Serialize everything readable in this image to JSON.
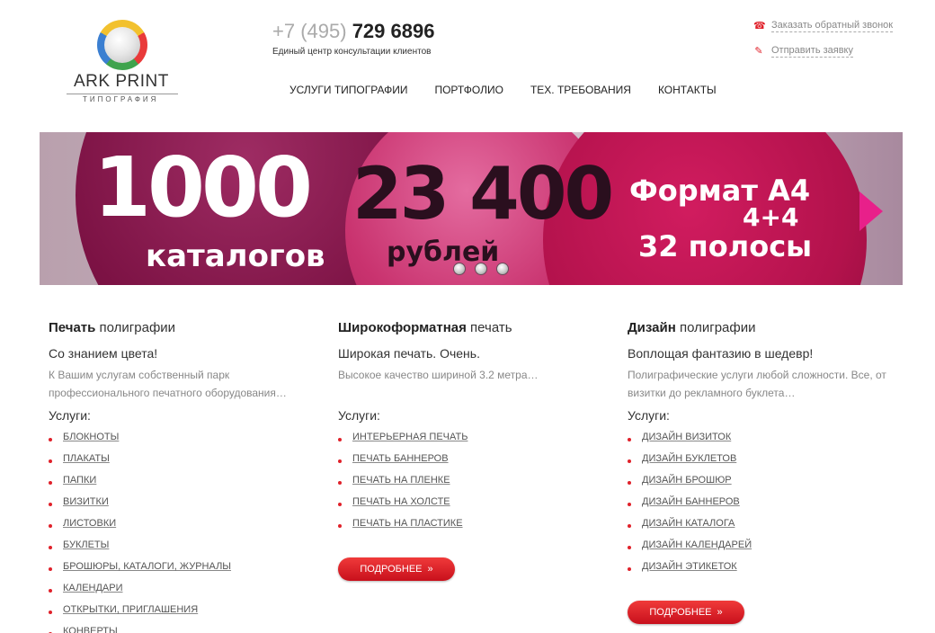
{
  "logo": {
    "name": "ARK PRINT",
    "subtitle": "ТИПОГРАФИЯ"
  },
  "header": {
    "phone_prefix": "+7 (495)",
    "phone_number": "729 6896",
    "phone_caption": "Единый центр консультации клиентов",
    "callback_link": "Заказать обратный звонок",
    "request_link": "Отправить заявку"
  },
  "nav": {
    "items": [
      "УСЛУГИ ТИПОГРАФИИ",
      "ПОРТФОЛИО",
      "ТЕХ. ТРЕБОВАНИЯ",
      "КОНТАКТЫ"
    ]
  },
  "banner": {
    "quantity": "1000",
    "quantity_label": "каталогов",
    "price": "23 400",
    "price_label": "рублей",
    "format": "Формат А4",
    "colors": "4+4",
    "pages": "32 полосы",
    "dots_count": 3
  },
  "columns": [
    {
      "title_bold": "Печать",
      "title_rest": " полиграфии",
      "tagline": "Со знанием цвета!",
      "description": "К Вашим услугам собственный парк профессионального печатного оборудования…",
      "services_label": "Услуги:",
      "services": [
        "БЛОКНОТЫ",
        "ПЛАКАТЫ",
        "ПАПКИ",
        "ВИЗИТКИ",
        "ЛИСТОВКИ",
        "БУКЛЕТЫ",
        "БРОШЮРЫ, КАТАЛОГИ, ЖУРНАЛЫ",
        "КАЛЕНДАРИ",
        "ОТКРЫТКИ, ПРИГЛАШЕНИЯ",
        "КОНВЕРТЫ"
      ]
    },
    {
      "title_bold": "Широкоформатная",
      "title_rest": " печать",
      "tagline": "Широкая печать. Очень.",
      "description": "Высокое качество шириной 3.2 метра…",
      "services_label": "Услуги:",
      "services": [
        "ИНТЕРЬЕРНАЯ ПЕЧАТЬ",
        "ПЕЧАТЬ БАННЕРОВ",
        "ПЕЧАТЬ НА ПЛЕНКЕ",
        "ПЕЧАТЬ НА ХОЛСТЕ",
        "ПЕЧАТЬ НА ПЛАСТИКЕ"
      ],
      "more_button": "ПОДРОБНЕЕ"
    },
    {
      "title_bold": "Дизайн",
      "title_rest": " полиграфии",
      "tagline": "Воплощая фантазию в шедевр!",
      "description": "Полиграфические услуги любой сложности. Все, от визитки до рекламного буклета…",
      "services_label": "Услуги:",
      "services": [
        "ДИЗАЙН ВИЗИТОК",
        "ДИЗАЙН БУКЛЕТОВ",
        "ДИЗАЙН БРОШЮР",
        "ДИЗАЙН БАННЕРОВ",
        "ДИЗАЙН КАТАЛОГА",
        "ДИЗАЙН КАЛЕНДАРЕЙ",
        "ДИЗАЙН ЭТИКЕТОК"
      ],
      "more_button": "ПОДРОБНЕЕ"
    }
  ],
  "colors": {
    "accent_red": "#e0212a",
    "banner_pink": "#e8208a"
  },
  "icons": {
    "callback": "phone-icon",
    "request": "edit-icon",
    "more": "double-chevron-right-icon"
  }
}
